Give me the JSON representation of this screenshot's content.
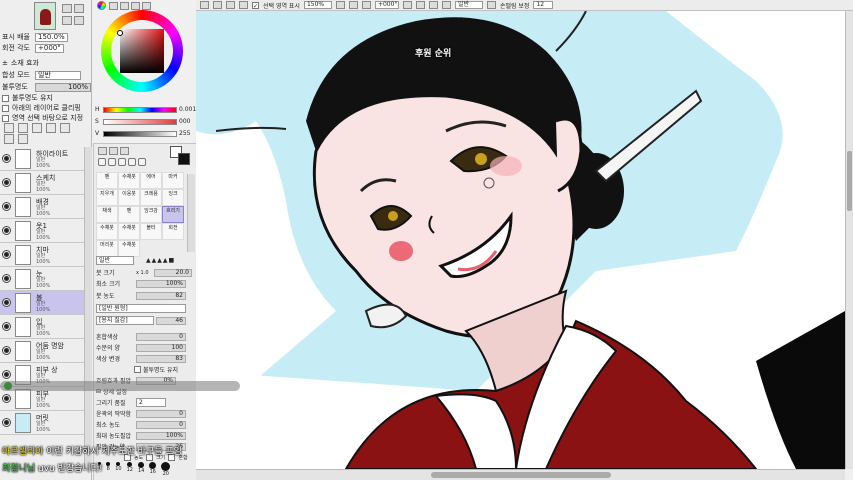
{
  "layer_panel": {
    "props": [
      {
        "label": "표시 배율",
        "value": "150.0%"
      },
      {
        "label": "회전 각도",
        "value": "+000°"
      }
    ],
    "section_layer_effect": "소재 효과",
    "blend_mode_label": "합성 모드",
    "blend_mode_value": "일반",
    "opacity_label": "불투명도",
    "opacity_value": "100%",
    "options": [
      "불투명도 유지",
      "아래의 레이어로 클리핑",
      "영역 선택 바탕으로 지정"
    ],
    "layers": [
      {
        "name": "하이라이트",
        "mode": "일반",
        "opacity": "100%",
        "selected": false
      },
      {
        "name": "스케치",
        "mode": "일반",
        "opacity": "100%",
        "selected": false
      },
      {
        "name": "배경",
        "mode": "일반",
        "opacity": "100%",
        "selected": false
      },
      {
        "name": "옷1",
        "mode": "일반",
        "opacity": "100%",
        "selected": false
      },
      {
        "name": "치마",
        "mode": "일반",
        "opacity": "100%",
        "selected": false
      },
      {
        "name": "눈",
        "mode": "일반",
        "opacity": "100%",
        "selected": false
      },
      {
        "name": "볼",
        "mode": "일반",
        "opacity": "100%",
        "selected": true
      },
      {
        "name": "입",
        "mode": "일반",
        "opacity": "100%",
        "selected": false
      },
      {
        "name": "어둠 명암",
        "mode": "일반",
        "opacity": "100%",
        "selected": false
      },
      {
        "name": "피부 상",
        "mode": "일반",
        "opacity": "100%",
        "selected": false
      },
      {
        "name": "피부",
        "mode": "일반",
        "opacity": "100%",
        "selected": false
      },
      {
        "name": "머릿",
        "mode": "일반",
        "opacity": "100%",
        "selected": false
      }
    ]
  },
  "color_panel": {
    "sliders": [
      {
        "label": "H",
        "value": "0.001",
        "color": "#ff2a2a"
      },
      {
        "label": "S",
        "value": "000",
        "color": "#e23c3c"
      },
      {
        "label": "V",
        "value": "255",
        "color": "#777777"
      }
    ]
  },
  "tool_panel": {
    "brushes": [
      {
        "label": "펜"
      },
      {
        "label": "수채붓"
      },
      {
        "label": "에어"
      },
      {
        "label": "마커"
      },
      {
        "label": "지우개"
      },
      {
        "label": "이응붓"
      },
      {
        "label": "크레용"
      },
      {
        "label": "잉크"
      },
      {
        "label": "채색"
      },
      {
        "label": "펜"
      },
      {
        "label": "잉크강"
      },
      {
        "label": "흐리기",
        "selected": true
      },
      {
        "label": "수채붓"
      },
      {
        "label": "수채붓"
      },
      {
        "label": "볼터"
      },
      {
        "label": "회전"
      },
      {
        "label": "머리붓"
      },
      {
        "label": "수채붓"
      }
    ],
    "mode_value": "일반",
    "brush_size_label": "붓 크기",
    "brush_size_prefix": "x 1.0",
    "brush_size_value": "20.0",
    "min_size_label": "최소 크기",
    "min_size_value": "100%",
    "density_label": "붓 농도",
    "density_value": "82",
    "shape_label": "[일반 원형]",
    "texture_label": "[용지 질감]",
    "texture_strength": "46",
    "props": [
      {
        "label": "혼합색상",
        "value": "0"
      },
      {
        "label": "수분의 양",
        "value": "100"
      },
      {
        "label": "색상 변경",
        "value": "83"
      }
    ],
    "keep_opacity": "불투명도 유지",
    "blur_label": "흐림효과 필압",
    "blur_value": "0%",
    "detail_section": "상세 설정",
    "detail_props": [
      {
        "label": "그리기 품질",
        "value": "2"
      },
      {
        "label": "윤곽의 딱딱함",
        "value": "0"
      },
      {
        "label": "최소 농도",
        "value": "0"
      },
      {
        "label": "최대 농도필압",
        "value": "100%"
      },
      {
        "label": "필압 강>약",
        "value": "26"
      }
    ],
    "pressure_labels": [
      "농도",
      "크기",
      "혼합"
    ],
    "dot_sizes": [
      "7",
      "8",
      "10",
      "12",
      "14",
      "16",
      "20"
    ]
  },
  "toolbar": {
    "selection_show": "선택 영역 표시",
    "zoom": "150%",
    "rotation": "+000°",
    "mode": "일반",
    "stabilizer_label": "손떨림 보정",
    "stabilizer_value": "12"
  },
  "canvas": {
    "overlay_title": "후원 순위"
  },
  "stream_chat": [
    {
      "user": "아르셀리아",
      "message": "이런 키감하시 제주도한 바구들 프임"
    },
    {
      "user": "최점니님",
      "message": "uvu 반갑습니다!"
    }
  ],
  "colors": {
    "sky": "#c6ecf6",
    "skin": "#fae3e3",
    "hair": "#111111",
    "hanbok_red": "#8b1212",
    "collar": "#ffffff",
    "selected_layer": "#c9c4ee"
  }
}
